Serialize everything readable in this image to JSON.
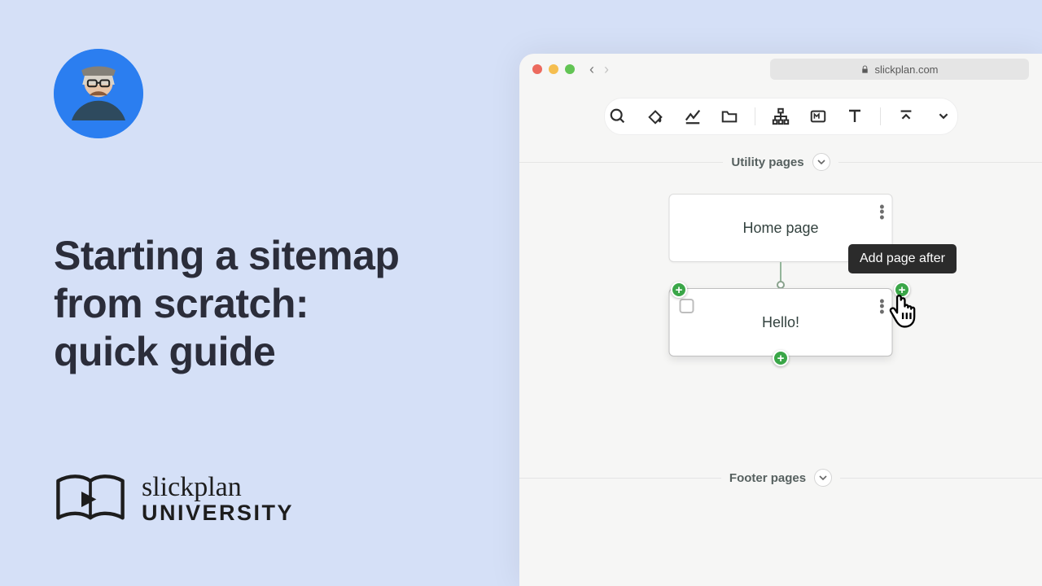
{
  "left": {
    "title_l1": "Starting a sitemap",
    "title_l2": "from scratch:",
    "title_l3": "quick guide"
  },
  "brand": {
    "top": "slickplan",
    "bottom": "UNIVERSITY"
  },
  "browser": {
    "url": "slickplan.com"
  },
  "sections": {
    "utility": "Utility pages",
    "footer": "Footer pages"
  },
  "nodes": {
    "home": "Home page",
    "hello": "Hello!"
  },
  "tooltip": "Add page after",
  "toolbar_icons": [
    "search",
    "fill",
    "chart",
    "folder",
    "sitemap",
    "markdown",
    "text",
    "collapse",
    "expand"
  ]
}
